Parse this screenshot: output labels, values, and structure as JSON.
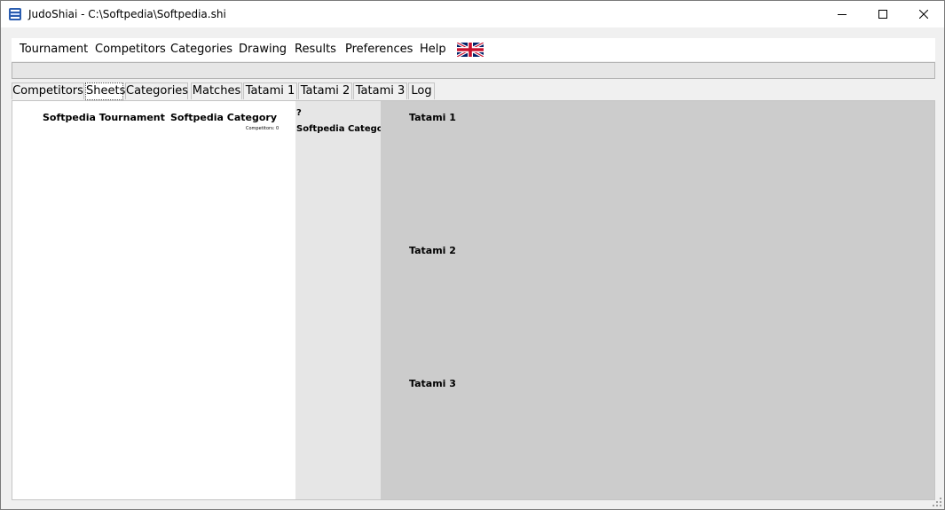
{
  "window": {
    "title": "JudoShiai - C:\\Softpedia\\Softpedia.shi",
    "icons": {
      "app": "judoshiai-app-icon",
      "minimize": "minimize-icon",
      "maximize": "maximize-icon",
      "close": "close-icon"
    }
  },
  "menubar": {
    "items": [
      "Tournament",
      "Competitors",
      "Categories",
      "Drawing",
      "Results",
      "Preferences",
      "Help"
    ],
    "language_flag": "uk-flag-icon"
  },
  "tabs": {
    "items": [
      "Competitors",
      "Sheets",
      "Categories",
      "Matches",
      "Tatami 1",
      "Tatami 2",
      "Tatami 3",
      "Log"
    ],
    "active": "Sheets"
  },
  "sheet": {
    "tournament_name": "Softpedia Tournament",
    "category_name": "Softpedia Category",
    "competitors_label": "Competitors: 0"
  },
  "mid_panel": {
    "question_mark": "?",
    "category_name": "Softpedia Category"
  },
  "tatami_panel": {
    "headings": [
      "Tatami 1",
      "Tatami 2",
      "Tatami 3"
    ]
  },
  "colors": {
    "titlebar": "#ffffff",
    "background": "#f0f0f0",
    "tatami_panel": "#cccccc",
    "mid_panel": "#e6e6e6"
  }
}
